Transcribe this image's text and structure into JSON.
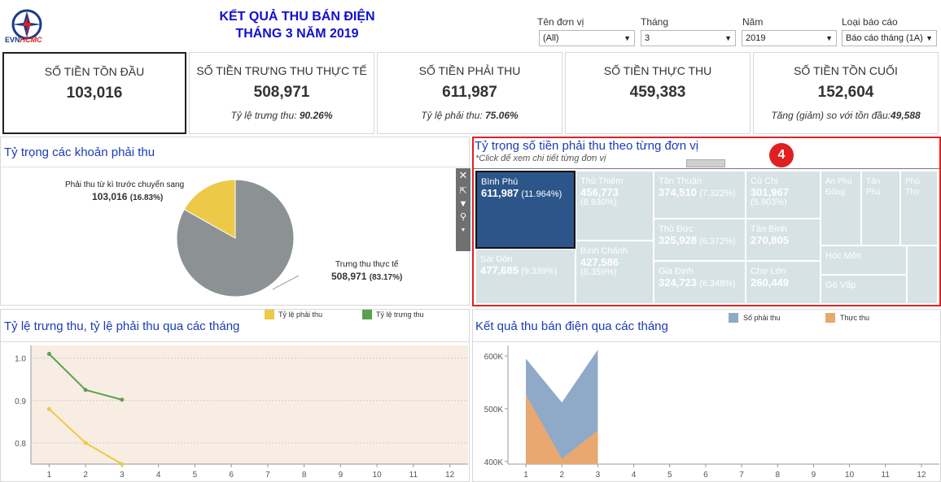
{
  "header": {
    "logo_text_evn": "EVN",
    "logo_text_hcmc": "HCMC",
    "title_line1": "KẾT QUẢ THU BÁN ĐIỆN",
    "title_line2": "THÁNG 3 NĂM 2019"
  },
  "filters": [
    {
      "label": "Tên đơn vị",
      "value": "(All)"
    },
    {
      "label": "Tháng",
      "value": "3"
    },
    {
      "label": "Năm",
      "value": "2019"
    },
    {
      "label": "Loại báo cáo",
      "value": "Báo cáo tháng (1A)"
    }
  ],
  "kpis": [
    {
      "label": "SỐ TIỀN TỒN ĐẦU",
      "value": "103,016",
      "sub_label": "",
      "sub_value": ""
    },
    {
      "label": "SỐ TIỀN TRƯNG THU THỰC TẾ",
      "value": "508,971",
      "sub_label": "Tỷ lệ trưng thu:",
      "sub_value": "90.26%"
    },
    {
      "label": "SỐ TIỀN PHẢI THU",
      "value": "611,987",
      "sub_label": "Tỷ lệ phải thu:",
      "sub_value": "75.06%"
    },
    {
      "label": "SỐ TIỀN THỰC THU",
      "value": "459,383",
      "sub_label": "",
      "sub_value": ""
    },
    {
      "label": "SỐ TIỀN TỒN CUỐI",
      "value": "152,604",
      "sub_label": "Tăng (giảm) so với tồn đầu:",
      "sub_value": "49,588"
    }
  ],
  "pie_panel": {
    "title": "Tỷ trọng các khoản phải thu",
    "slice1_label": "Phải thu từ kì trước chuyển sang",
    "slice1_value": "103,016",
    "slice1_pct": "(16.83%)",
    "slice2_label": "Trưng thu thực tế",
    "slice2_value": "508,971",
    "slice2_pct": "(83.17%)"
  },
  "tree_panel": {
    "title": "Tỷ trọng số tiền phải thu theo từng đơn vị",
    "subtitle": "*Click để xem chi tiết từng đơn vị",
    "marker": "4",
    "nodes": [
      {
        "name": "Bình Phú",
        "value": "611,987",
        "pct": "(11.964%)"
      },
      {
        "name": "Thủ Thiêm",
        "value": "456,773",
        "pct": "(8.930%)"
      },
      {
        "name": "Tân Thuận",
        "value": "374,510",
        "pct": "(7.322%)"
      },
      {
        "name": "Củ Chi",
        "value": "301,967",
        "pct": "(5.903%)"
      },
      {
        "name": "An Phú Đông",
        "value": "",
        "pct": ""
      },
      {
        "name": "Tân Phú",
        "value": "",
        "pct": ""
      },
      {
        "name": "Phú Thọ",
        "value": "",
        "pct": ""
      },
      {
        "name": "Thủ Đức",
        "value": "325,928",
        "pct": "(6.372%)"
      },
      {
        "name": "Tân Bình",
        "value": "270,805",
        "pct": ""
      },
      {
        "name": "Sài Gòn",
        "value": "477,685",
        "pct": "(9.339%)"
      },
      {
        "name": "Bình Chánh",
        "value": "427,586",
        "pct": "(8.359%)"
      },
      {
        "name": "Hóc Môn",
        "value": "",
        "pct": ""
      },
      {
        "name": "Gia Định",
        "value": "324,723",
        "pct": "(6.348%)"
      },
      {
        "name": "Chợ Lớn",
        "value": "260,449",
        "pct": ""
      },
      {
        "name": "Gò Vấp",
        "value": "",
        "pct": ""
      }
    ]
  },
  "colors": {
    "accent": "#1a3db5",
    "pie_gray": "#8c9294",
    "pie_yellow": "#edc948",
    "line_green": "#59a14f",
    "line_yellow": "#edc948",
    "area_blue": "#8fa9c8",
    "area_orange": "#e8a870",
    "tree_selected": "#2c5689",
    "tree_other": "#d7e2e6",
    "highlight_red": "#e02020"
  },
  "line_chart_meta": {
    "title": "Tỷ lệ trưng thu, tỷ lệ phải thu qua các tháng",
    "legend_a": "Tỷ lệ phải thu",
    "legend_b": "Tỷ lệ trưng thu"
  },
  "area_chart_meta": {
    "title": "Kết quả thu bán điện qua các tháng",
    "legend_a": "Số phải thu",
    "legend_b": "Thực thu"
  },
  "chart_data": [
    {
      "type": "pie",
      "categories": [
        "Phải thu từ kì trước chuyển sang",
        "Trưng thu thực tế"
      ],
      "values": [
        103016,
        508971
      ],
      "title": "Tỷ trọng các khoản phải thu"
    },
    {
      "type": "line",
      "title": "Tỷ lệ trưng thu, tỷ lệ phải thu qua các tháng",
      "x": [
        1,
        2,
        3
      ],
      "x_ticks": [
        "1",
        "2",
        "3",
        "4",
        "5",
        "6",
        "7",
        "8",
        "9",
        "10",
        "11",
        "12"
      ],
      "y_ticks": [
        "1.0",
        "0.9",
        "0.8"
      ],
      "ylim": [
        0.75,
        1.03
      ],
      "series": [
        {
          "name": "Tỷ lệ phải thu",
          "values": [
            0.88,
            0.8,
            0.75
          ]
        },
        {
          "name": "Tỷ lệ trưng thu",
          "values": [
            1.01,
            0.925,
            0.902
          ]
        }
      ]
    },
    {
      "type": "area",
      "title": "Kết quả thu bán điện qua các tháng",
      "x": [
        1,
        2,
        3
      ],
      "x_ticks": [
        "1",
        "2",
        "3",
        "4",
        "5",
        "6",
        "7",
        "8",
        "9",
        "10",
        "11",
        "12"
      ],
      "y_ticks": [
        "600K",
        "500K",
        "400K"
      ],
      "ylim": [
        395000,
        620000
      ],
      "series": [
        {
          "name": "Số phải thu",
          "values": [
            595000,
            512000,
            612000
          ]
        },
        {
          "name": "Thực thu",
          "values": [
            527000,
            405000,
            459383
          ]
        }
      ]
    }
  ]
}
